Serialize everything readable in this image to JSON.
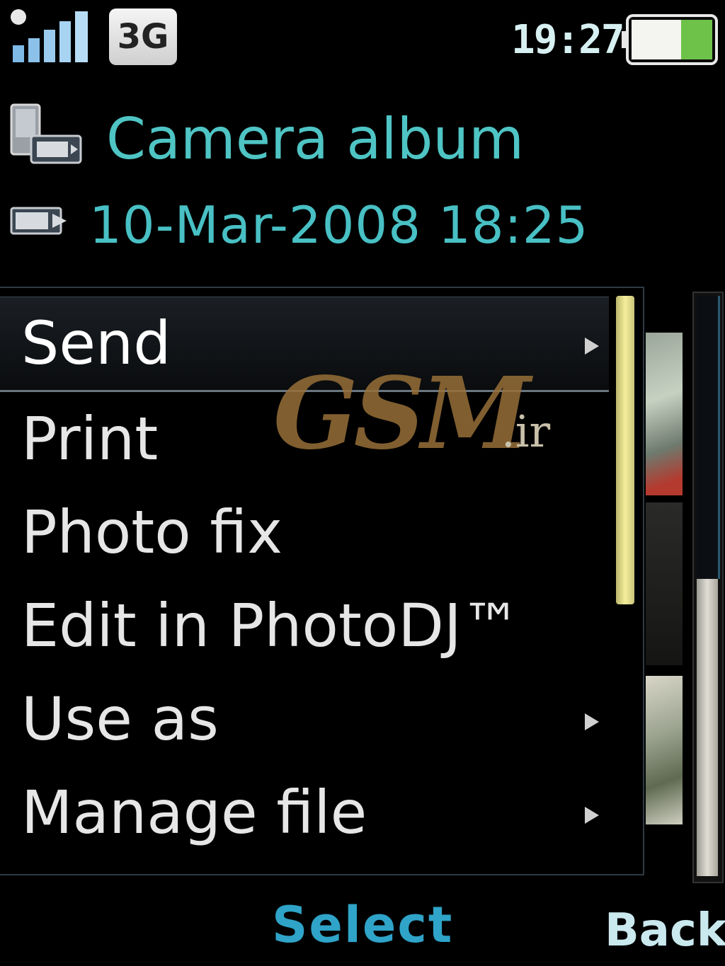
{
  "status_bar": {
    "network_type": "3G",
    "time": "19:27",
    "signal_bars": 5,
    "battery_level": 0.35
  },
  "header": {
    "title": "Camera album",
    "date": "10-Mar-2008 18:25"
  },
  "menu": {
    "items": [
      {
        "label": "Send",
        "has_submenu": true,
        "selected": true
      },
      {
        "label": "Print",
        "has_submenu": false
      },
      {
        "label": "Photo fix",
        "has_submenu": false
      },
      {
        "label": "Edit in PhotoDJ™",
        "has_submenu": false
      },
      {
        "label": "Use as",
        "has_submenu": true
      },
      {
        "label": "Manage file",
        "has_submenu": true
      }
    ]
  },
  "watermark": {
    "main": "GSM",
    "suffix": ".ir"
  },
  "softkeys": {
    "center": "Select",
    "right": "Back"
  },
  "colors": {
    "accent_teal": "#4fc4c4",
    "softkey_blue": "#2fa3c8",
    "scroll_thumb": "#f5ef9c",
    "battery_green": "#6ec24a"
  }
}
